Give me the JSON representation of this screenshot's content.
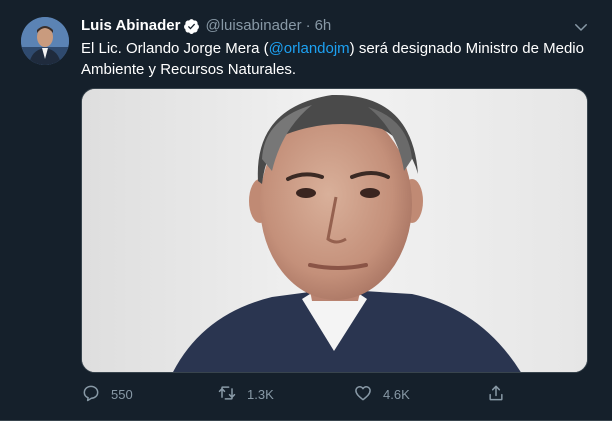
{
  "tweet": {
    "display_name": "Luis Abinader",
    "handle": "@luisabinader",
    "separator": "·",
    "time": "6h",
    "text_before": "El Lic. Orlando Jorge Mera (",
    "mention": "@orlandojm",
    "text_after": ") será designado Ministro de Medio Ambiente y Recursos Naturales.",
    "verified_icon": "verified-badge-icon",
    "media_description": "portrait-photo"
  },
  "actions": {
    "reply_count": "550",
    "retweet_count": "1.3K",
    "like_count": "4.6K"
  },
  "colors": {
    "background": "#15202b",
    "text": "#ffffff",
    "secondary": "#8899a6",
    "accent": "#1da1f2",
    "border": "#38444d"
  }
}
